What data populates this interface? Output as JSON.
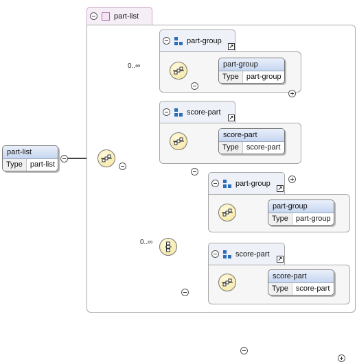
{
  "root": {
    "name": "part-list",
    "type_key": "Type",
    "type_value": "part-list"
  },
  "container": {
    "title": "part-list"
  },
  "sequence": {
    "kind": "sequence",
    "cardinality": "0..∞",
    "groups": [
      {
        "title": "part-group",
        "element": {
          "name": "part-group",
          "type_key": "Type",
          "type_value": "part-group"
        }
      },
      {
        "title": "score-part",
        "element": {
          "name": "score-part",
          "type_key": "Type",
          "type_value": "score-part"
        }
      }
    ]
  },
  "choice": {
    "kind": "choice",
    "cardinality": "0..∞",
    "groups": [
      {
        "title": "part-group",
        "element": {
          "name": "part-group",
          "type_key": "Type",
          "type_value": "part-group"
        }
      },
      {
        "title": "score-part",
        "element": {
          "name": "score-part",
          "type_key": "Type",
          "type_value": "score-part"
        }
      }
    ]
  },
  "icons": {
    "collapse": "minus-circle-icon",
    "expand": "plus-circle-icon",
    "complex_type": "complex-type-icon",
    "group": "group-icon",
    "reference": "reference-arrow-icon",
    "sequence": "sequence-icon",
    "choice": "choice-icon"
  },
  "colors": {
    "header": "#c6d6f0",
    "compositor": "#f4e39a",
    "frame": "#a8a8a8"
  }
}
